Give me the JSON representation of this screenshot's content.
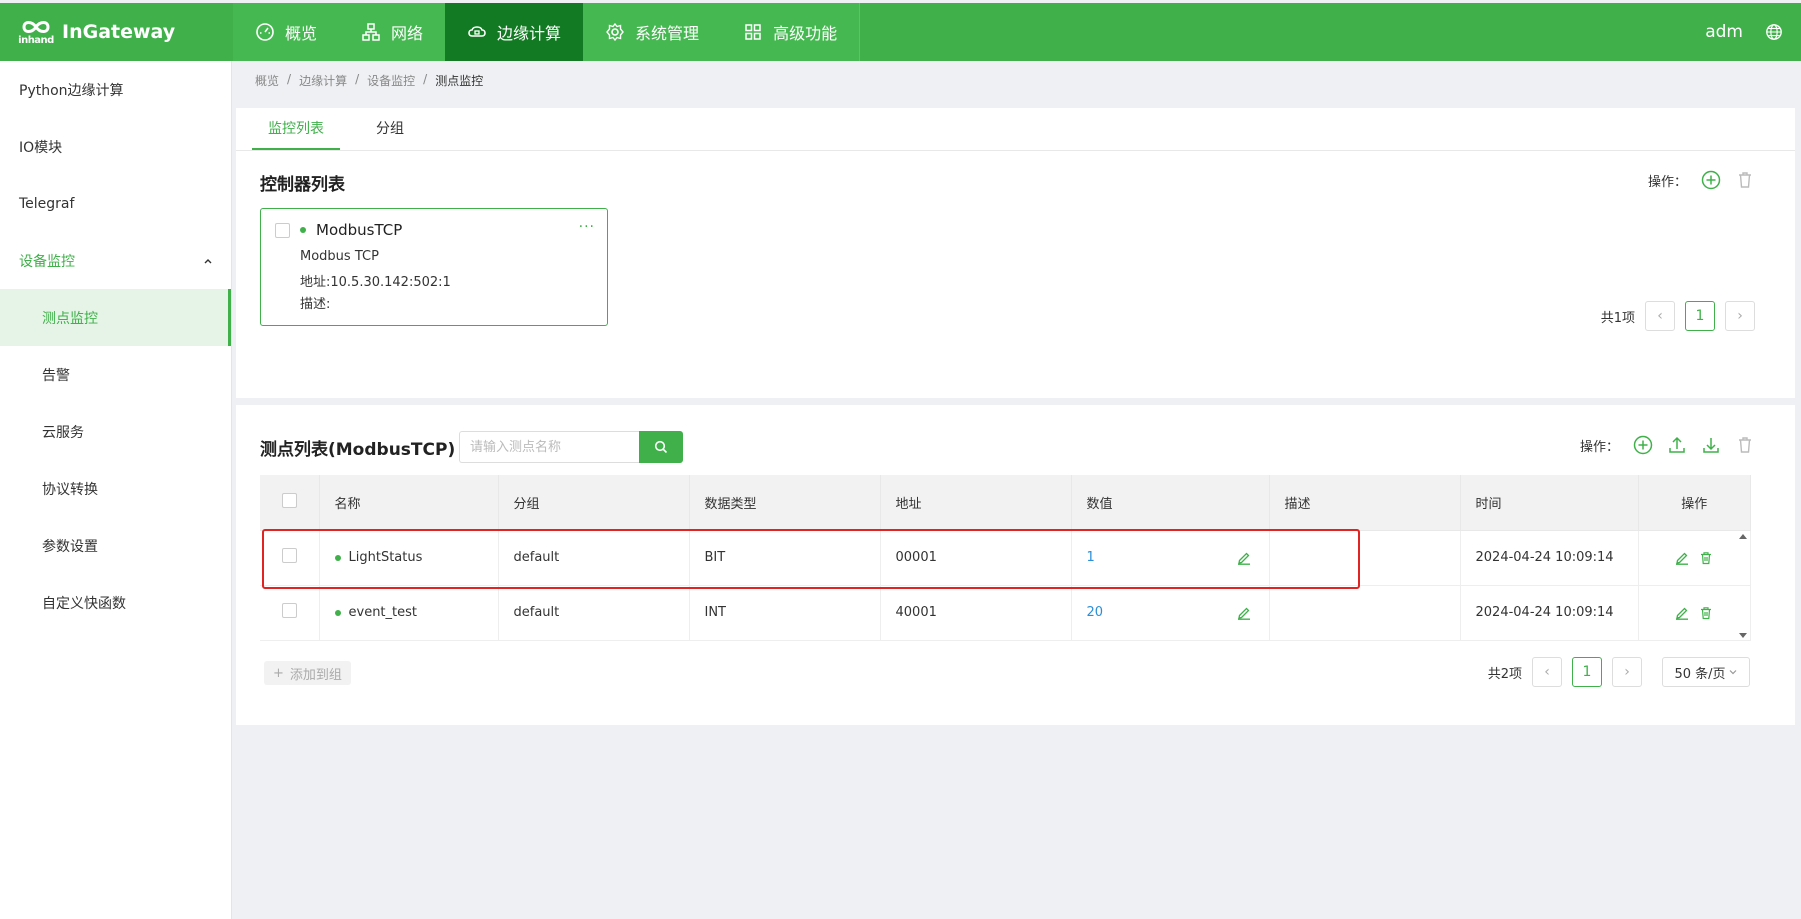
{
  "header": {
    "logo_brand": "inhand",
    "logo_text": "InGateway",
    "nav": [
      {
        "label": "概览",
        "icon": "dashboard-icon"
      },
      {
        "label": "网络",
        "icon": "network-icon"
      },
      {
        "label": "边缘计算",
        "icon": "edge-cloud-icon",
        "active": true
      },
      {
        "label": "系统管理",
        "icon": "gear-icon"
      },
      {
        "label": "高级功能",
        "icon": "grid-icon"
      }
    ],
    "user": "adm",
    "lang_icon": "globe-icon"
  },
  "sidebar": {
    "items": [
      {
        "label": "Python边缘计算"
      },
      {
        "label": "IO模块"
      },
      {
        "label": "Telegraf"
      },
      {
        "label": "设备监控"
      },
      {
        "label": "测点监控"
      },
      {
        "label": "告警"
      },
      {
        "label": "云服务"
      },
      {
        "label": "协议转换"
      },
      {
        "label": "参数设置"
      },
      {
        "label": "自定义快函数"
      }
    ]
  },
  "breadcrumb": [
    "概览",
    "边缘计算",
    "设备监控",
    "测点监控"
  ],
  "tabs": [
    "监控列表",
    "分组"
  ],
  "controllers": {
    "title": "控制器列表",
    "ops_label": "操作：",
    "card": {
      "name": "ModbusTCP",
      "protocol": "Modbus TCP",
      "address": "地址:10.5.30.142:502:1",
      "desc": "描述:",
      "more": "···"
    },
    "pager": {
      "total": "共1项",
      "page": "1"
    }
  },
  "points": {
    "title": "测点列表(ModbusTCP)",
    "search_placeholder": "请输入测点名称",
    "ops_label": "操作：",
    "columns": [
      "名称",
      "分组",
      "数据类型",
      "地址",
      "数值",
      "描述",
      "时间",
      "操作"
    ],
    "rows": [
      {
        "name": "LightStatus",
        "group": "default",
        "type": "BIT",
        "addr": "00001",
        "value": "1",
        "desc": "",
        "time": "2024-04-24 10:09:14"
      },
      {
        "name": "event_test",
        "group": "default",
        "type": "INT",
        "addr": "40001",
        "value": "20",
        "desc": "",
        "time": "2024-04-24 10:09:14"
      }
    ],
    "add_to_group": "添加到组",
    "pager": {
      "total": "共2项",
      "page": "1",
      "page_size": "50 条/页"
    }
  },
  "colors": {
    "primary": "#3fb04a",
    "nav_active": "#127a22",
    "highlight": "#e02424",
    "value": "#2b8fd8"
  }
}
